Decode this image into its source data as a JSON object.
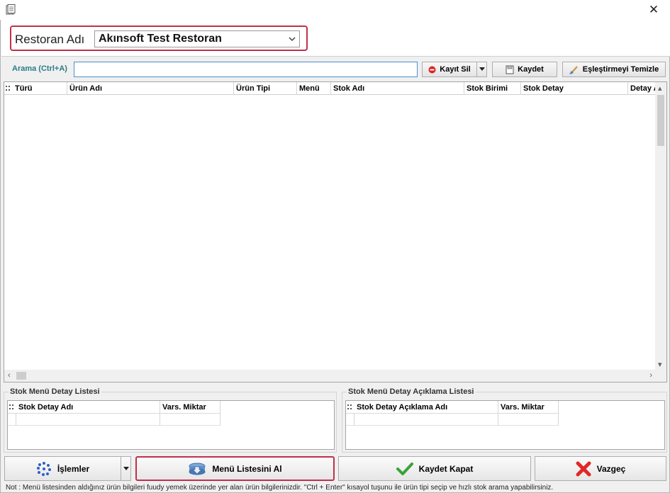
{
  "window": {
    "close_glyph": "✕"
  },
  "restaurant": {
    "label": "Restoran Adı",
    "value": "Akınsoft Test Restoran"
  },
  "search": {
    "label": "Arama (Ctrl+A)",
    "value": "",
    "placeholder": ""
  },
  "toolbar": {
    "delete_label": "Kayıt Sil",
    "save_label": "Kaydet",
    "clear_match_label": "Eşleştirmeyi Temizle"
  },
  "grid": {
    "columns": [
      "Türü",
      "Ürün Adı",
      "Ürün Tipi",
      "Menü",
      "Stok Adı",
      "Stok Birimi",
      "Stok Detay",
      "Detay A"
    ],
    "rows": []
  },
  "detail_panel": {
    "title": "Stok Menü Detay Listesi",
    "columns": [
      "Stok Detay Adı",
      "Vars. Miktar"
    ]
  },
  "desc_panel": {
    "title": "Stok Menü Detay Açıklama Listesi",
    "columns": [
      "Stok Detay Açıklama Adı",
      "Vars. Miktar"
    ]
  },
  "bottom_buttons": {
    "operations": "İşlemler",
    "get_menu": "Menü Listesini Al",
    "save_close": "Kaydet Kapat",
    "cancel": "Vazgeç"
  },
  "note": "Not :  Menü listesinden aldığınız ürün bilgileri fuudy yemek üzerinde yer alan ürün bilgilerinizdir. \"Ctrl + Enter\" kısayol tuşunu ile ürün tipi seçip ve hızlı stok arama yapabilirsiniz.",
  "colors": {
    "highlight": "#c0304b",
    "search_label": "#2c7c84",
    "input_border": "#4a8fd0"
  },
  "icons": [
    "app-icon",
    "close-icon",
    "chevron-down-icon",
    "delete-icon",
    "save-icon",
    "clear-brush-icon",
    "operations-dots-icon",
    "download-icon",
    "checkmark-icon",
    "cross-icon"
  ]
}
